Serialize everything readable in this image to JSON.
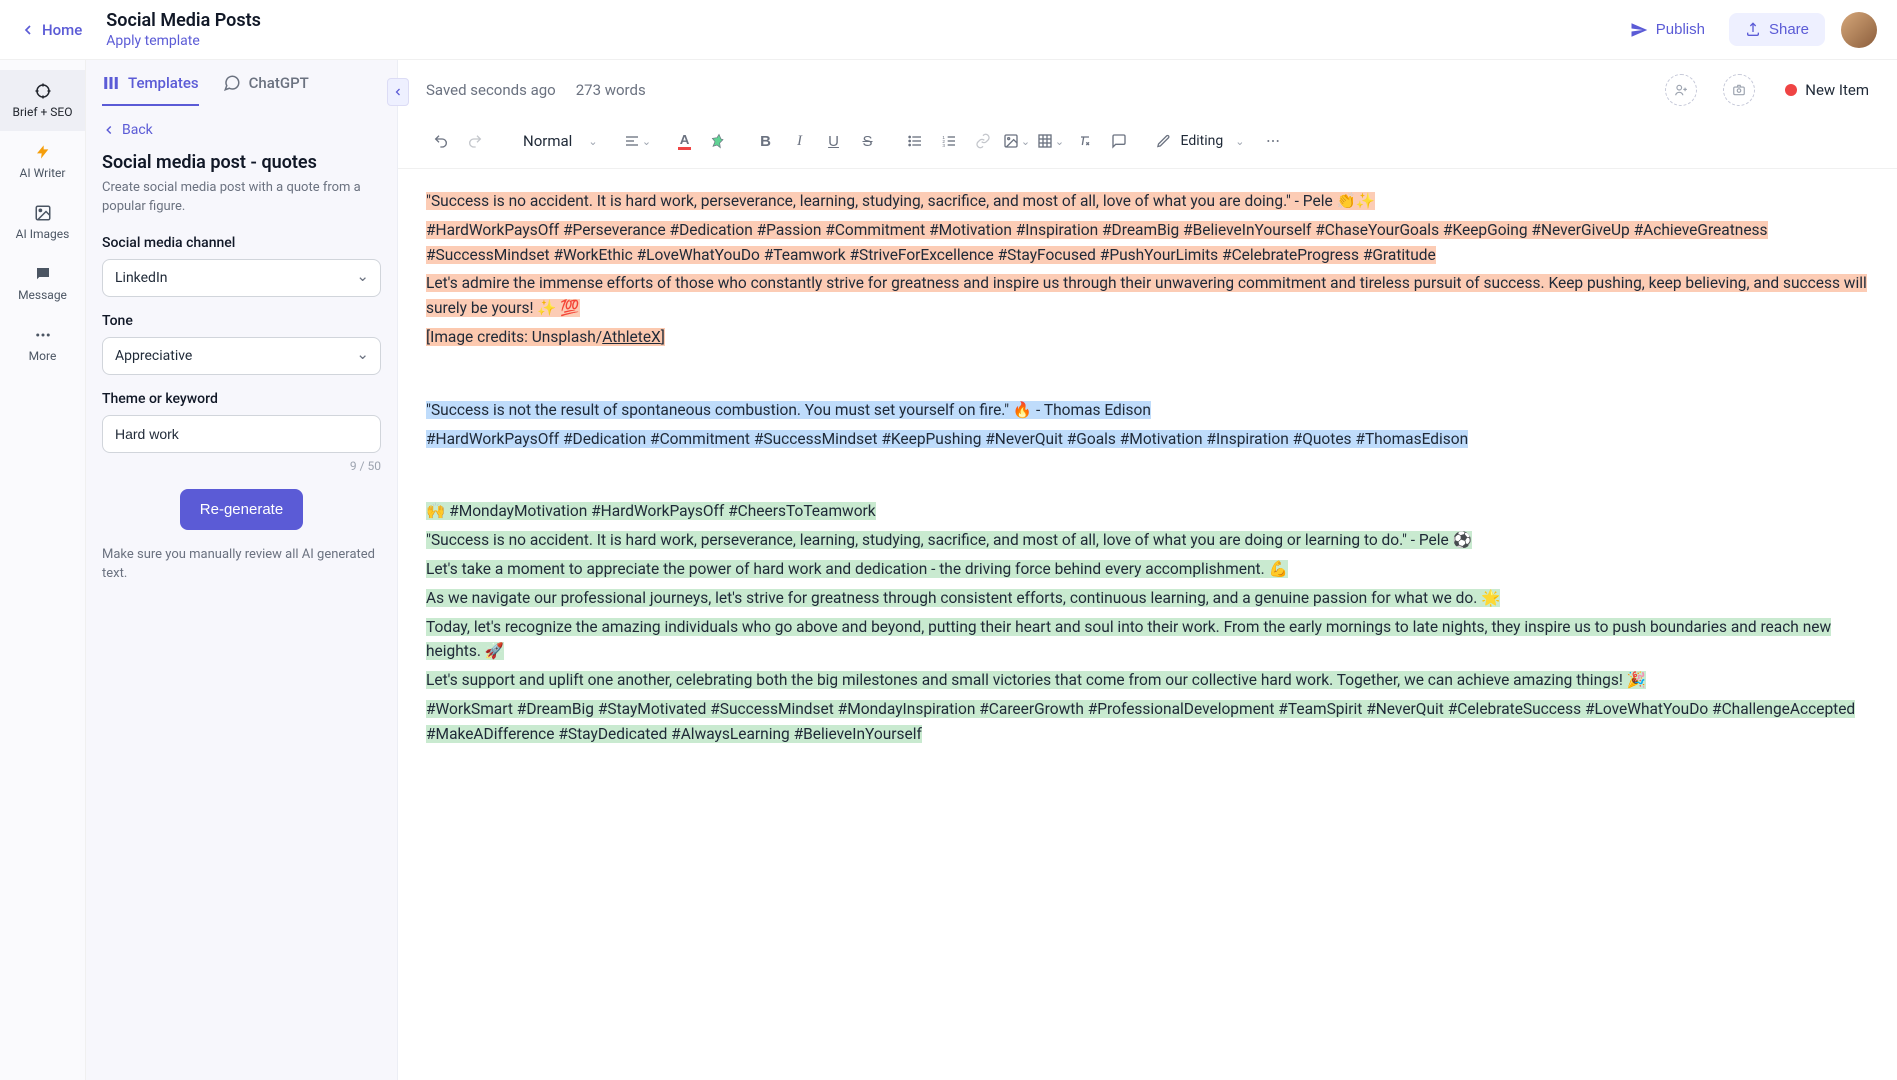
{
  "topbar": {
    "home": "Home",
    "title": "Social Media Posts",
    "apply_template": "Apply template",
    "publish": "Publish",
    "share": "Share",
    "avatar_initials": ""
  },
  "rail": {
    "brief": "Brief + SEO",
    "writer": "AI Writer",
    "images": "AI Images",
    "message": "Message",
    "more": "More"
  },
  "sidebar": {
    "tab_templates": "Templates",
    "tab_chatgpt": "ChatGPT",
    "back": "Back",
    "title": "Social media post - quotes",
    "desc": "Create social media post with a quote from a popular figure.",
    "channel_label": "Social media channel",
    "channel_value": "LinkedIn",
    "tone_label": "Tone",
    "tone_value": "Appreciative",
    "theme_label": "Theme or keyword",
    "theme_value": "Hard work",
    "char_count": "9 / 50",
    "regen": "Re-generate",
    "note": "Make sure you manually review all AI generated text."
  },
  "editor": {
    "saved": "Saved seconds ago",
    "words": "273 words",
    "status": "New Item",
    "style_select": "Normal",
    "editing_label": "Editing"
  },
  "content": {
    "p1": "\"Success is no accident. It is hard work, perseverance, learning, studying, sacrifice, and most of all, love of what you are doing.\" - Pele 👏✨",
    "p2": "#HardWorkPaysOff #Perseverance #Dedication #Passion #Commitment #Motivation #Inspiration #DreamBig #BelieveInYourself #ChaseYourGoals #KeepGoing #NeverGiveUp #AchieveGreatness #SuccessMindset #WorkEthic #LoveWhatYouDo #Teamwork #StriveForExcellence #StayFocused #PushYourLimits #CelebrateProgress #Gratitude",
    "p3": "Let's admire the immense efforts of those who constantly strive for greatness and inspire us through their unwavering commitment and tireless pursuit of success. Keep pushing, keep believing, and success will surely be yours! ✨ 💯",
    "p4_a": "[Image credits: Unsplash/",
    "p4_link": "AthleteX",
    "p4_b": "]",
    "p5": "\"Success is not the result of spontaneous combustion. You must set yourself on fire.\" 🔥 - Thomas Edison",
    "p6": "#HardWorkPaysOff #Dedication #Commitment #SuccessMindset #KeepPushing #NeverQuit #Goals #Motivation #Inspiration #Quotes #ThomasEdison",
    "p7": "🙌 #MondayMotivation #HardWorkPaysOff #CheersToTeamwork",
    "p8": "\"Success is no accident. It is hard work, perseverance, learning, studying, sacrifice, and most of all, love of what you are doing or learning to do.\" - Pele ⚽",
    "p9": "Let's take a moment to appreciate the power of hard work and dedication - the driving force behind every accomplishment. 💪",
    "p10": "As we navigate our professional journeys, let's strive for greatness through consistent efforts, continuous learning, and a genuine passion for what we do. 🌟",
    "p11": "Today, let's recognize the amazing individuals who go above and beyond, putting their heart and soul into their work. From the early mornings to late nights, they inspire us to push boundaries and reach new heights. 🚀",
    "p12": "Let's support and uplift one another, celebrating both the big milestones and small victories that come from our collective hard work. Together, we can achieve amazing things! 🎉",
    "p13": "#WorkSmart #DreamBig #StayMotivated #SuccessMindset #MondayInspiration #CareerGrowth #ProfessionalDevelopment #TeamSpirit #NeverQuit #CelebrateSuccess #LoveWhatYouDo #ChallengeAccepted #MakeADifference #StayDedicated #AlwaysLearning #BelieveInYourself"
  }
}
